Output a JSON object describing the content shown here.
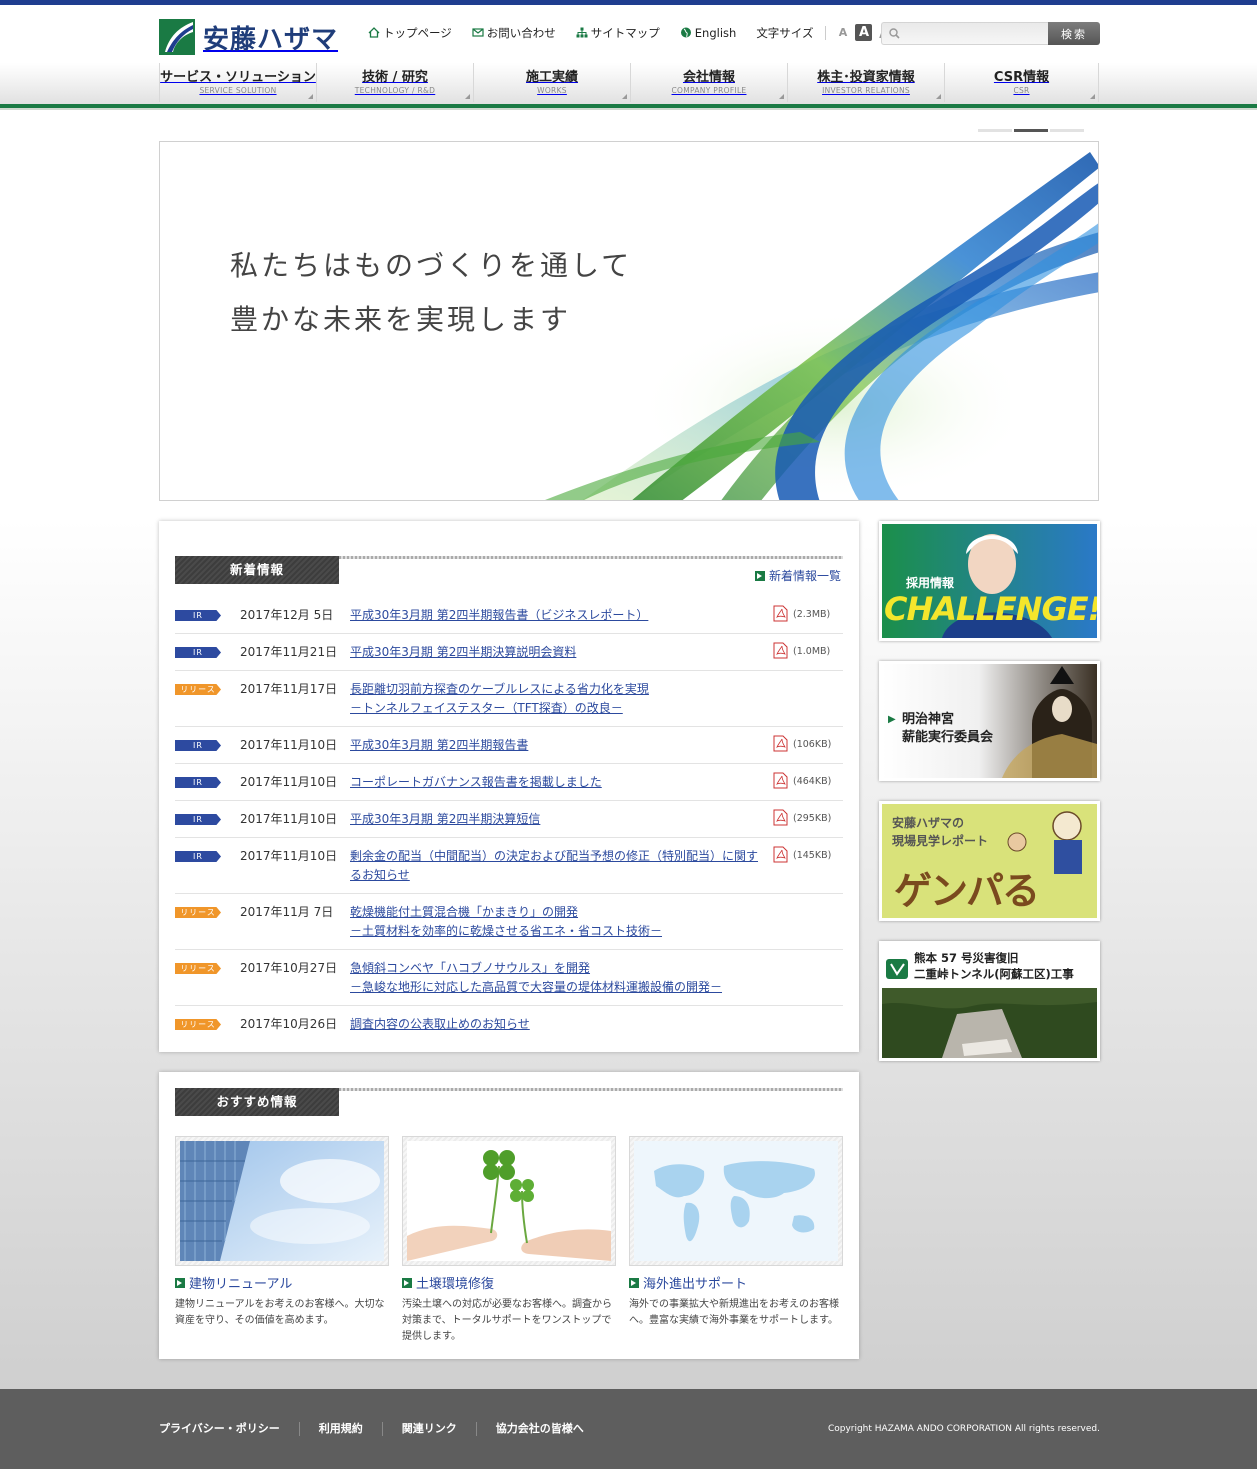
{
  "header": {
    "logo_text": "安藤ハザマ",
    "util_links": [
      {
        "label": "トップページ",
        "icon": "home-icon"
      },
      {
        "label": "お問い合わせ",
        "icon": "mail-icon"
      },
      {
        "label": "サイトマップ",
        "icon": "sitemap-icon"
      },
      {
        "label": "English",
        "icon": "globe-icon"
      }
    ],
    "font_size_label": "文字サイズ",
    "font_sizes": [
      "A",
      "A",
      "A"
    ],
    "search_placeholder": "",
    "search_button": "検索"
  },
  "gnav": [
    {
      "jp": "サービス・ソリューション",
      "en": "SERVICE SOLUTION"
    },
    {
      "jp": "技術 / 研究",
      "en": "TECHNOLOGY / R&D"
    },
    {
      "jp": "施工実績",
      "en": "WORKS"
    },
    {
      "jp": "会社情報",
      "en": "COMPANY PROFILE"
    },
    {
      "jp": "株主･投資家情報",
      "en": "INVESTOR RELATIONS"
    },
    {
      "jp": "CSR情報",
      "en": "CSR"
    }
  ],
  "hero": {
    "line1": "私たちはものづくりを通して",
    "line2": "豊かな未来を実現します"
  },
  "news": {
    "heading": "新着情報",
    "more_label": "新着情報一覧",
    "items": [
      {
        "tag": "IR",
        "date": "2017年12月 5日",
        "title": "平成30年3月期 第2四半期報告書（ビジネスレポート）",
        "sub": "",
        "pdf": "(2.3MB)"
      },
      {
        "tag": "IR",
        "date": "2017年11月21日",
        "title": "平成30年3月期 第2四半期決算説明会資料",
        "sub": "",
        "pdf": "(1.0MB)"
      },
      {
        "tag": "リリース",
        "date": "2017年11月17日",
        "title": "長距離切羽前方探査のケーブルレスによる省力化を実現",
        "sub": "－トンネルフェイステスター（TFT探査）の改良－",
        "pdf": ""
      },
      {
        "tag": "IR",
        "date": "2017年11月10日",
        "title": "平成30年3月期 第2四半期報告書",
        "sub": "",
        "pdf": "(106KB)"
      },
      {
        "tag": "IR",
        "date": "2017年11月10日",
        "title": "コーポレートガバナンス報告書を掲載しました",
        "sub": "",
        "pdf": "(464KB)"
      },
      {
        "tag": "IR",
        "date": "2017年11月10日",
        "title": "平成30年3月期 第2四半期決算短信",
        "sub": "",
        "pdf": "(295KB)"
      },
      {
        "tag": "IR",
        "date": "2017年11月10日",
        "title": "剰余金の配当（中間配当）の決定および配当予想の修正（特別配当）に関するお知らせ",
        "sub": "",
        "pdf": "(145KB)"
      },
      {
        "tag": "リリース",
        "date": "2017年11月 7日",
        "title": "乾燥機能付土質混合機「かまきり」の開発",
        "sub": "－土質材料を効率的に乾燥させる省エネ・省コスト技術－",
        "pdf": ""
      },
      {
        "tag": "リリース",
        "date": "2017年10月27日",
        "title": "急傾斜コンベヤ「ハコブノサウルス」を開発",
        "sub": "－急峻な地形に対応した高品質で大容量の堤体材料運搬設備の開発－",
        "pdf": ""
      },
      {
        "tag": "リリース",
        "date": "2017年10月26日",
        "title": "調査内容の公表取止めのお知らせ",
        "sub": "",
        "pdf": ""
      }
    ]
  },
  "reco": {
    "heading": "おすすめ情報",
    "cards": [
      {
        "title": "建物リニューアル",
        "desc": "建物リニューアルをお考えのお客様へ。大切な資産を守り、その価値を高めます。"
      },
      {
        "title": "土壌環境修復",
        "desc": "汚染土壌への対応が必要なお客様へ。調査から対策まで、トータルサポートをワンストップで提供します。"
      },
      {
        "title": "海外進出サポート",
        "desc": "海外での事業拡大や新規進出をお考えのお客様へ。豊富な実績で海外事業をサポートします。"
      }
    ]
  },
  "banners": {
    "recruit_label": "採用情報",
    "recruit_word": "CHALLENGE!!",
    "meiji_line1": "明治神宮",
    "meiji_line2": "薪能実行委員会",
    "genba_line1": "安藤ハザマの",
    "genba_line2": "現場見学レポート",
    "genba_word": "ゲンパる",
    "kuma_line1": "熊本 57 号災害復旧",
    "kuma_line2": "二重峠トンネル(阿蘇工区)工事"
  },
  "footer": {
    "links": [
      "プライバシー・ポリシー",
      "利用規約",
      "関連リンク",
      "協力会社の皆様へ"
    ],
    "copyright": "Copyright HAZAMA ANDO CORPORATION All rights reserved."
  },
  "colors": {
    "brand_blue": "#1f3d8f",
    "brand_green": "#1a7a44",
    "link": "#2c4a9e",
    "ir_badge": "#2d4aa0",
    "release_badge": "#f0962a"
  }
}
